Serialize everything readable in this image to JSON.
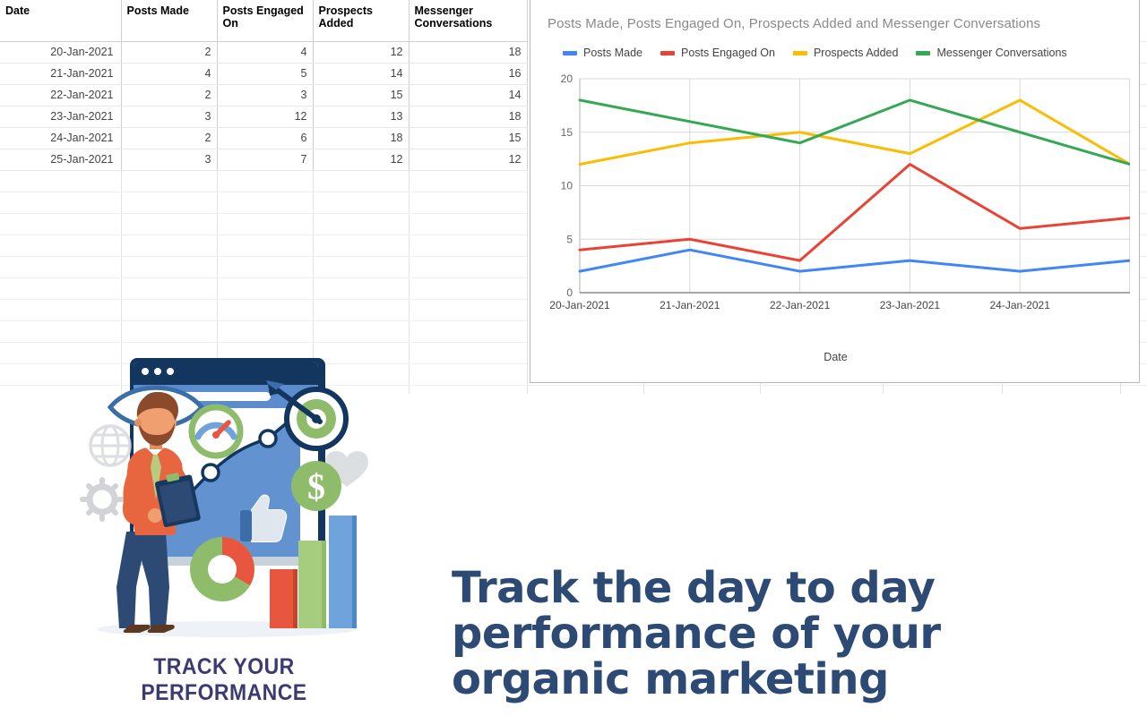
{
  "spreadsheet": {
    "table": {
      "headers": [
        "Date",
        "Posts Made",
        "Posts Engaged On",
        "Prospects Added",
        "Messenger Conversations"
      ],
      "rows": [
        {
          "date": "20-Jan-2021",
          "posts_made": "2",
          "posts_engaged_on": "4",
          "prospects_added": "12",
          "messenger_conversations": "18"
        },
        {
          "date": "21-Jan-2021",
          "posts_made": "4",
          "posts_engaged_on": "5",
          "prospects_added": "14",
          "messenger_conversations": "16"
        },
        {
          "date": "22-Jan-2021",
          "posts_made": "2",
          "posts_engaged_on": "3",
          "prospects_added": "15",
          "messenger_conversations": "14"
        },
        {
          "date": "23-Jan-2021",
          "posts_made": "3",
          "posts_engaged_on": "12",
          "prospects_added": "13",
          "messenger_conversations": "18"
        },
        {
          "date": "24-Jan-2021",
          "posts_made": "2",
          "posts_engaged_on": "6",
          "prospects_added": "18",
          "messenger_conversations": "15"
        },
        {
          "date": "25-Jan-2021",
          "posts_made": "3",
          "posts_engaged_on": "7",
          "prospects_added": "12",
          "messenger_conversations": "12"
        }
      ]
    }
  },
  "chart_data": {
    "type": "line",
    "title": "Posts Made, Posts Engaged On, Prospects Added and Messenger Conversations",
    "xlabel": "Date",
    "ylabel": "",
    "categories": [
      "20-Jan-2021",
      "21-Jan-2021",
      "22-Jan-2021",
      "23-Jan-2021",
      "24-Jan-2021",
      "25-Jan-2021"
    ],
    "visible_xticks": [
      "20-Jan-2021",
      "21-Jan-2021",
      "22-Jan-2021",
      "23-Jan-2021",
      "24-Jan-2021"
    ],
    "yticks": [
      "0",
      "5",
      "10",
      "15",
      "20"
    ],
    "ylim": [
      0,
      20
    ],
    "grid": true,
    "legend_position": "top",
    "series": [
      {
        "name": "Posts Made",
        "color": "#4285f4",
        "values": [
          2,
          4,
          2,
          3,
          2,
          3
        ]
      },
      {
        "name": "Posts Engaged On",
        "color": "#ea4335",
        "values": [
          4,
          5,
          3,
          12,
          6,
          7
        ]
      },
      {
        "name": "Prospects Added",
        "color": "#fbbc04",
        "values": [
          12,
          14,
          15,
          13,
          18,
          12
        ]
      },
      {
        "name": "Messenger Conversations",
        "color": "#34a853",
        "values": [
          18,
          16,
          14,
          18,
          15,
          12
        ]
      }
    ]
  },
  "illustration": {
    "caption": "TRACK YOUR PERFORMANCE",
    "alt": "businessman-with-clipboard-analytics-illustration"
  },
  "headline": {
    "line1": "Track the day to day",
    "line2": "performance of your",
    "line3": "organic marketing",
    "color": "#2d4a74"
  }
}
